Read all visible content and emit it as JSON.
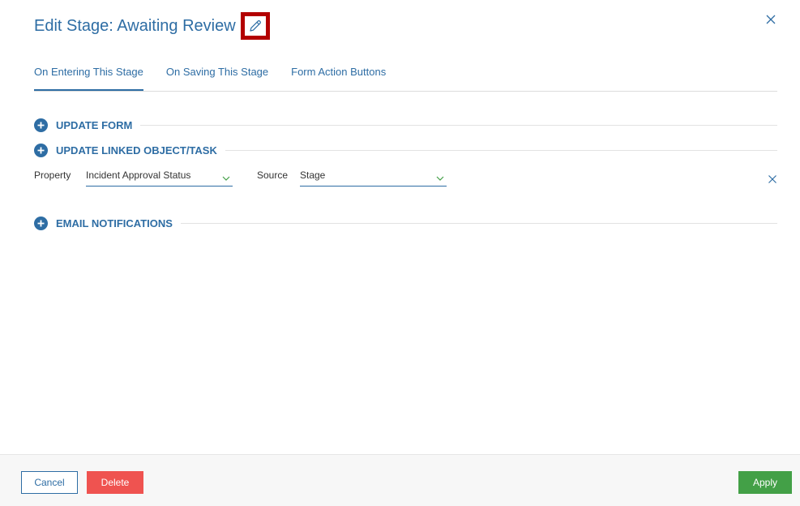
{
  "dialog": {
    "title": "Edit Stage: Awaiting Review",
    "edit_title_icon": "pencil-icon",
    "close_icon": "close-icon"
  },
  "tabs": [
    {
      "label": "On Entering This Stage",
      "active": true
    },
    {
      "label": "On Saving This Stage",
      "active": false
    },
    {
      "label": "Form Action Buttons",
      "active": false
    }
  ],
  "sections": {
    "update_form": {
      "label": "UPDATE FORM",
      "icon": "plus-circle-icon"
    },
    "update_linked": {
      "label": "UPDATE LINKED OBJECT/TASK",
      "icon": "plus-circle-icon"
    },
    "email_notifications": {
      "label": "EMAIL NOTIFICATIONS",
      "icon": "plus-circle-icon"
    }
  },
  "linked_row": {
    "property_label": "Property",
    "property_value": "Incident Approval Status",
    "source_label": "Source",
    "source_value": "Stage",
    "remove_icon": "close-icon"
  },
  "footer": {
    "cancel_label": "Cancel",
    "delete_label": "Delete",
    "apply_label": "Apply"
  },
  "colors": {
    "primary": "#2e6da4",
    "highlight_box": "#b30000",
    "delete": "#ef5350",
    "apply": "#43a047",
    "chevron": "#43a047"
  }
}
